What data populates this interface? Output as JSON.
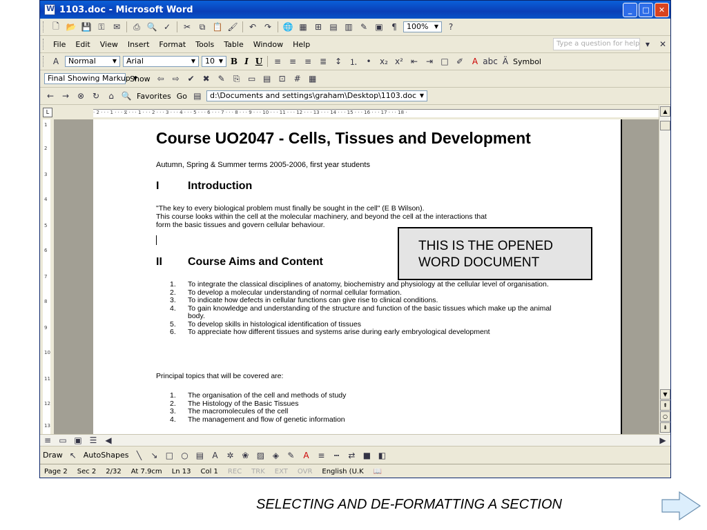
{
  "window": {
    "title": "1103.doc - Microsoft Word",
    "controls": [
      "_",
      "□",
      "✕"
    ]
  },
  "menu": {
    "items": [
      "File",
      "Edit",
      "View",
      "Insert",
      "Format",
      "Tools",
      "Table",
      "Window",
      "Help"
    ],
    "help_placeholder": "Type a question for help"
  },
  "standard_toolbar": {
    "zoom": "100%"
  },
  "formatting_toolbar": {
    "style": "Normal",
    "font": "Arial",
    "size": "10",
    "symbol_label": "Symbol"
  },
  "reviewing_toolbar": {
    "markup_mode": "Final Showing Markup",
    "show_label": "Show"
  },
  "web_toolbar": {
    "favorites_label": "Favorites",
    "go_label": "Go",
    "address": "d:\\Documents and settings\\graham\\Desktop\\1103.doc"
  },
  "document": {
    "title": "Course UO2047 - Cells, Tissues and Development",
    "subtitle": "Autumn, Spring & Summer terms 2005-2006, first year students",
    "section1": {
      "number": "I",
      "heading": "Introduction"
    },
    "intro_lines": [
      "\"The key to every biological problem must finally be sought in the cell\" (E B Wilson).",
      "This course looks within the cell at the molecular machinery, and beyond the cell at the interactions that",
      "form the basic tissues and govern cellular behaviour."
    ],
    "section2": {
      "number": "II",
      "heading": "Course Aims and Content"
    },
    "aims": [
      {
        "n": "1.",
        "text": "To integrate the classical disciplines of anatomy, biochemistry and physiology at the cellular level of organisation."
      },
      {
        "n": "2.",
        "text": "To develop a molecular understanding of normal cellular formation."
      },
      {
        "n": "3.",
        "text": "To indicate how defects in cellular functions can give rise to clinical conditions."
      },
      {
        "n": "4.",
        "text": "To gain knowledge and understanding of the structure and function of the basic tissues which make up the animal body."
      },
      {
        "n": "5.",
        "text": "To develop skills in histological identification of tissues"
      },
      {
        "n": "6.",
        "text": "To appreciate how different tissues and systems arise during early embryological development"
      }
    ],
    "topics_intro": "Principal topics that will be covered are:",
    "topics": [
      {
        "n": "1.",
        "text": "The organisation of the cell and methods of study"
      },
      {
        "n": "2.",
        "text": "The Histology of the Basic Tissues"
      },
      {
        "n": "3.",
        "text": "The macromolecules of the cell"
      },
      {
        "n": "4.",
        "text": "The management and flow of genetic information"
      }
    ]
  },
  "callout": {
    "line1": "THIS IS THE OPENED",
    "line2": "WORD DOCUMENT"
  },
  "drawing_toolbar": {
    "draw_label": "Draw",
    "autoshapes_label": "AutoShapes"
  },
  "status": {
    "page": "Page 2",
    "section": "Sec 2",
    "pages": "2/32",
    "at": "At 7.9cm",
    "line": "Ln 13",
    "col": "Col 1",
    "rec": "REC",
    "trk": "TRK",
    "ext": "EXT",
    "ovr": "OVR",
    "language": "English (U.K"
  },
  "caption": "SELECTING AND DE-FORMATTING A SECTION"
}
